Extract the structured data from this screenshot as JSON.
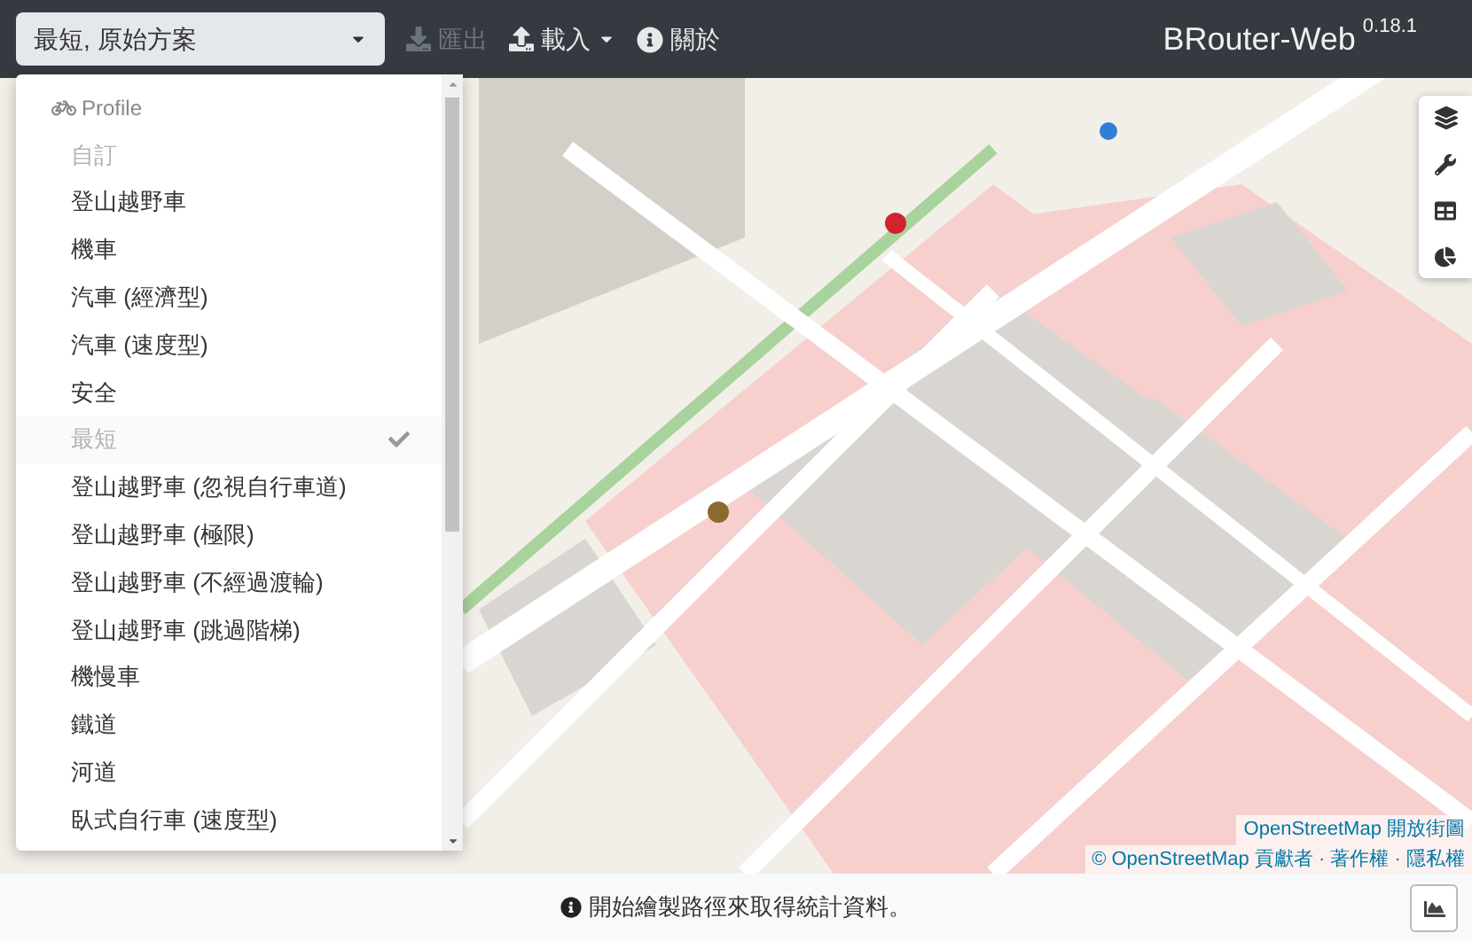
{
  "navbar": {
    "profile_select": "最短, 原始方案",
    "export": {
      "label": "匯出",
      "disabled": true
    },
    "load": {
      "label": "載入",
      "disabled": false
    },
    "about": "關於",
    "brand": "BRouter-Web",
    "version": "0.18.1"
  },
  "profile_menu": {
    "header": "Profile",
    "items": [
      {
        "label": "自訂",
        "selected": false,
        "disabled": true
      },
      {
        "label": "登山越野車",
        "selected": false,
        "disabled": false
      },
      {
        "label": "機車",
        "selected": false,
        "disabled": false
      },
      {
        "label": "汽車 (經濟型)",
        "selected": false,
        "disabled": false
      },
      {
        "label": "汽車 (速度型)",
        "selected": false,
        "disabled": false
      },
      {
        "label": "安全",
        "selected": false,
        "disabled": false
      },
      {
        "label": "最短",
        "selected": true,
        "disabled": true
      },
      {
        "label": "登山越野車 (忽視自行車道)",
        "selected": false,
        "disabled": false
      },
      {
        "label": "登山越野車 (極限)",
        "selected": false,
        "disabled": false
      },
      {
        "label": "登山越野車 (不經過渡輪)",
        "selected": false,
        "disabled": false
      },
      {
        "label": "登山越野車 (跳過階梯)",
        "selected": false,
        "disabled": false
      },
      {
        "label": "機慢車",
        "selected": false,
        "disabled": false
      },
      {
        "label": "鐵道",
        "selected": false,
        "disabled": false
      },
      {
        "label": "河道",
        "selected": false,
        "disabled": false
      },
      {
        "label": "臥式自行車 (速度型)",
        "selected": false,
        "disabled": false
      }
    ]
  },
  "attribution": {
    "layer": "OpenStreetMap 開放街圖",
    "copyright": "© OpenStreetMap 貢獻者 · 著作權 · 隱私權"
  },
  "footer": {
    "message": "開始繪製路徑來取得統計資料。"
  }
}
